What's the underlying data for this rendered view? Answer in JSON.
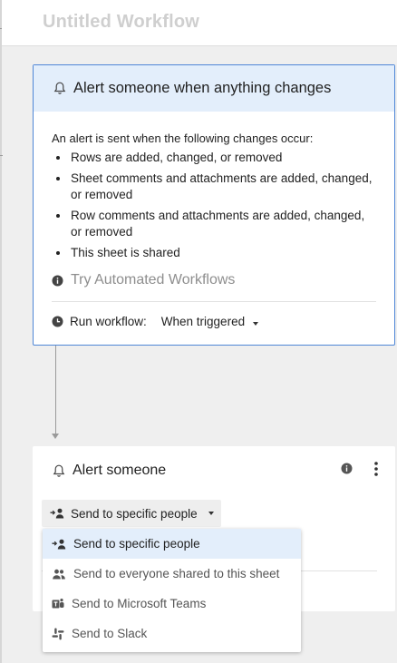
{
  "header": {
    "title": "Untitled Workflow"
  },
  "trigger": {
    "title": "Alert someone when anything changes",
    "description": "An alert is sent when the following changes occur:",
    "changes": [
      "Rows are added, changed, or removed",
      "Sheet comments and attachments are added, changed, or removed",
      "Row comments and attachments are added, changed, or removed",
      "This sheet is shared"
    ],
    "try_label": "Try Automated Workflows",
    "run_label": "Run workflow:",
    "run_value": "When triggered"
  },
  "action": {
    "title": "Alert someone",
    "recipient_button": "Send to specific people"
  },
  "dropdown": {
    "options": [
      {
        "label": "Send to specific people",
        "icon": "person-add-icon",
        "selected": true
      },
      {
        "label": "Send to everyone shared to this sheet",
        "icon": "people-icon",
        "selected": false
      },
      {
        "label": "Send to Microsoft Teams",
        "icon": "teams-icon",
        "selected": false
      },
      {
        "label": "Send to Slack",
        "icon": "slack-icon",
        "selected": false
      }
    ]
  },
  "colors": {
    "accent_border": "#4f86d6",
    "highlight": "#e3eefb",
    "background": "#efefef"
  }
}
